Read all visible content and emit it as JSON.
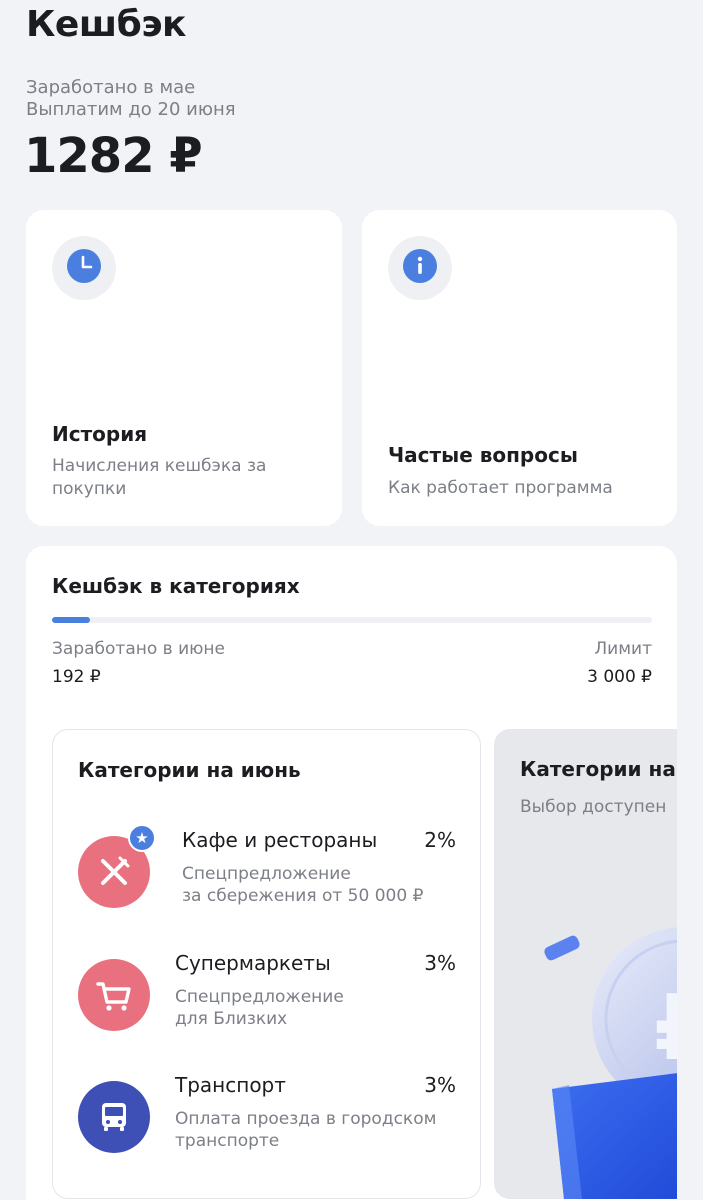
{
  "header": {
    "title": "Кешбэк",
    "earned_line1": "Заработано в мае",
    "earned_line2": "Выплатим до 20 июня",
    "amount": "1282 ₽"
  },
  "tiles": [
    {
      "title": "История",
      "subtitle": "Начисления кешбэка за покупки",
      "icon": "clock-icon"
    },
    {
      "title": "Частые вопросы",
      "subtitle": "Как работает программа",
      "icon": "info-icon"
    }
  ],
  "category_cashback": {
    "title": "Кешбэк в категориях",
    "progress_fraction": 0.064,
    "earned_label": "Заработано в июне",
    "earned_value": "192 ₽",
    "limit_label": "Лимит",
    "limit_value": "3 000 ₽",
    "current_card": {
      "title": "Категории на июнь",
      "items": [
        {
          "name": "Кафе и рестораны",
          "percent": "2%",
          "desc_line1": "Спецпредложение",
          "desc_line2": "за сбережения от 50 000 ₽",
          "icon": "cutlery-icon",
          "color": "#e9707f",
          "badge": "star-icon"
        },
        {
          "name": "Супермаркеты",
          "percent": "3%",
          "desc_line1": "Спецпредложение",
          "desc_line2": "для Близких",
          "icon": "shopping-cart-icon",
          "color": "#e9707f"
        },
        {
          "name": "Транспорт",
          "percent": "3%",
          "desc_line1": "Оплата проезда в городском",
          "desc_line2": "транспорте",
          "icon": "bus-icon",
          "color": "#3e4fb5"
        }
      ]
    },
    "next_card": {
      "title": "Категории на и",
      "subtitle": "Выбор доступен"
    }
  },
  "colors": {
    "accent": "#4a7fe0",
    "background": "#f2f3f7",
    "card": "#ffffff",
    "muted_text": "#7c7f87"
  }
}
